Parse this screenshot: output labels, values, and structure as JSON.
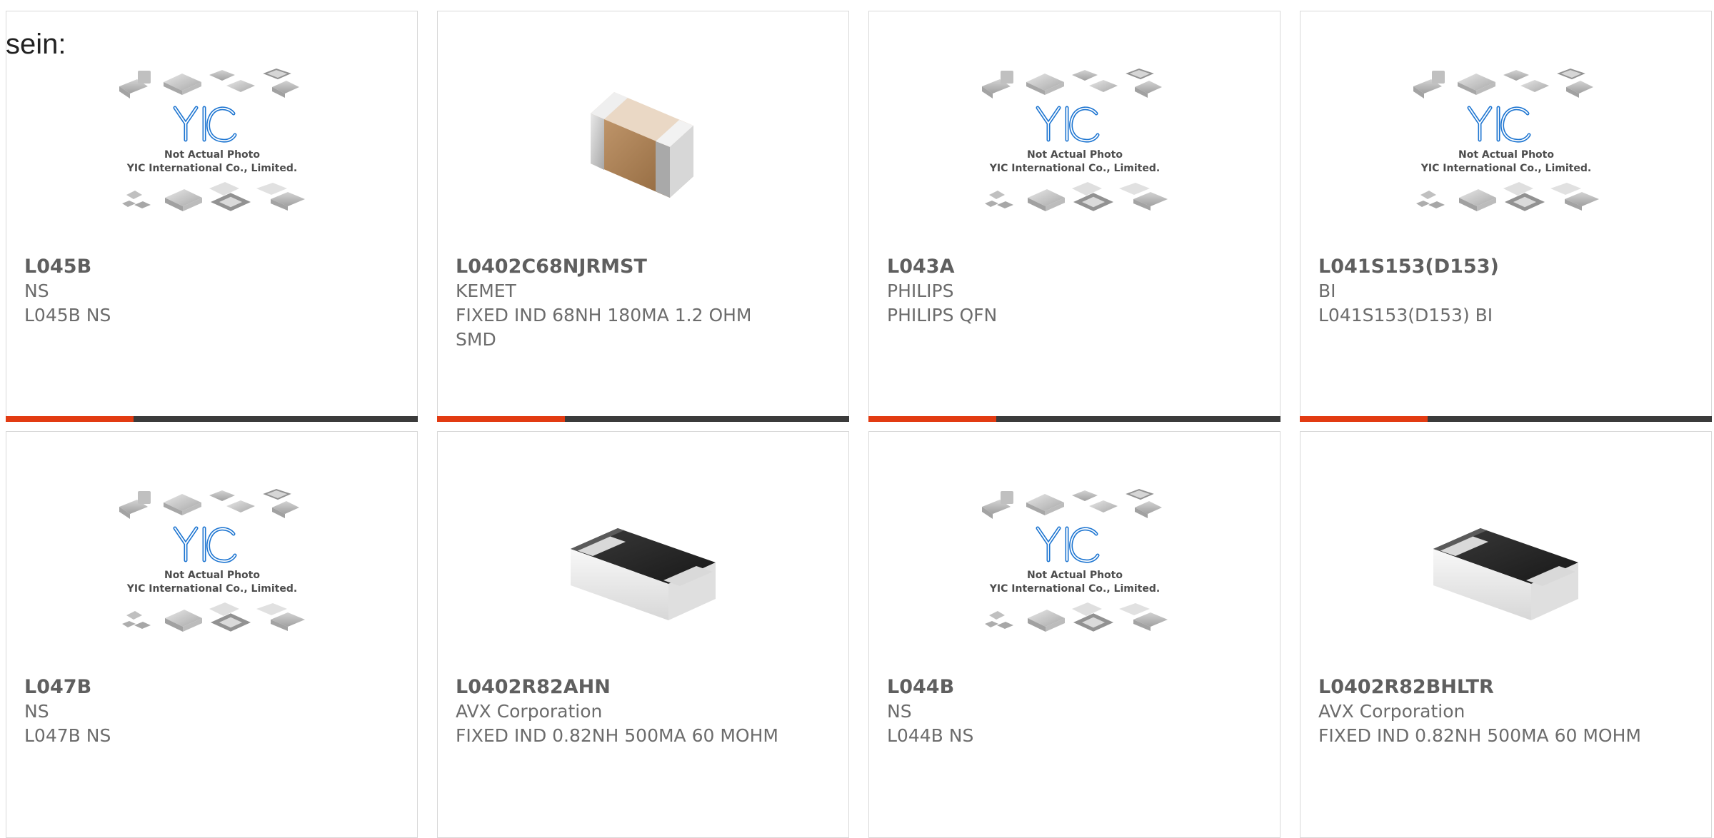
{
  "page": {
    "intro_text": "sein:"
  },
  "theme": {
    "accent_color": "#e23b12",
    "bar_color": "#3b3b3b",
    "border_color": "#d9d9d9"
  },
  "products": [
    {
      "part_number": "L045B",
      "brand": "NS",
      "description": "L045B NS",
      "image_type": "placeholder-photo",
      "image_caption_line1": "Not Actual Photo",
      "image_caption_line2": "YIC International Co., Limited.",
      "image_logo_text": "YIC",
      "accent_progress": 0.31
    },
    {
      "part_number": "L0402C68NJRMST",
      "brand": "KEMET",
      "description": "FIXED IND 68NH 180MA 1.2 OHM SMD",
      "image_type": "brown-chip-component",
      "accent_progress": 0.31
    },
    {
      "part_number": "L043A",
      "brand": "PHILIPS",
      "description": "PHILIPS QFN",
      "image_type": "placeholder-photo",
      "image_caption_line1": "Not Actual Photo",
      "image_caption_line2": "YIC International Co., Limited.",
      "image_logo_text": "YIC",
      "accent_progress": 0.31
    },
    {
      "part_number": "L041S153(D153)",
      "brand": "BI",
      "description": "L041S153(D153) BI",
      "image_type": "placeholder-photo",
      "image_caption_line1": "Not Actual Photo",
      "image_caption_line2": "YIC International Co., Limited.",
      "image_logo_text": "YIC",
      "accent_progress": 0.31
    },
    {
      "part_number": "L047B",
      "brand": "NS",
      "description": "L047B NS",
      "image_type": "placeholder-photo",
      "image_caption_line1": "Not Actual Photo",
      "image_caption_line2": "YIC International Co., Limited.",
      "image_logo_text": "YIC"
    },
    {
      "part_number": "L0402R82AHN",
      "brand": "AVX Corporation",
      "description": "FIXED IND 0.82NH 500MA 60 MOHM",
      "image_type": "black-chip-component"
    },
    {
      "part_number": "L044B",
      "brand": "NS",
      "description": "L044B NS",
      "image_type": "placeholder-photo",
      "image_caption_line1": "Not Actual Photo",
      "image_caption_line2": "YIC International Co., Limited.",
      "image_logo_text": "YIC"
    },
    {
      "part_number": "L0402R82BHLTR",
      "brand": "AVX Corporation",
      "description": "FIXED IND 0.82NH 500MA 60 MOHM",
      "image_type": "black-chip-component"
    }
  ]
}
